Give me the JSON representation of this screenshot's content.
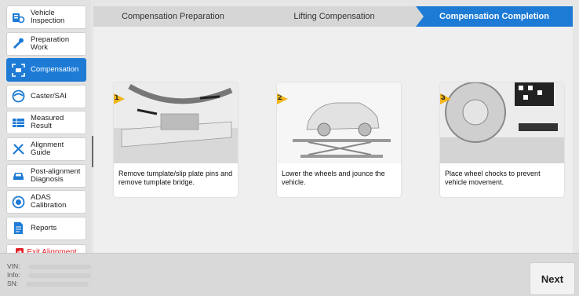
{
  "sidebar": {
    "items": [
      {
        "label": "Vehicle\nInspection",
        "icon": "vehicle-inspection-icon"
      },
      {
        "label": "Preparation\nWork",
        "icon": "wrench-icon"
      },
      {
        "label": "Compensation",
        "icon": "compensation-icon",
        "active": true
      },
      {
        "label": "Caster/SAI",
        "icon": "caster-icon"
      },
      {
        "label": "Measured\nResult",
        "icon": "table-icon"
      },
      {
        "label": "Alignment\nGuide",
        "icon": "tools-icon"
      },
      {
        "label": "Post-alignment\nDiagnosis",
        "icon": "car-icon"
      },
      {
        "label": "ADAS\nCalibration",
        "icon": "adas-icon"
      },
      {
        "label": "Reports",
        "icon": "document-icon"
      }
    ],
    "exit_label": "Exit Alignment"
  },
  "steps": [
    "Compensation Preparation",
    "Lifting Compensation",
    "Compensation Completion"
  ],
  "cards": [
    {
      "num": "1",
      "caption": "Remove tumplate/slip plate pins and remove tumplate bridge."
    },
    {
      "num": "2",
      "caption": "Lower the wheels and jounce the vehicle."
    },
    {
      "num": "3",
      "caption": "Place wheel chocks to prevent vehicle movement."
    }
  ],
  "footer": {
    "vin_label": "VIN:",
    "info_label": "Info:",
    "sn_label": "SN:",
    "next_label": "Next"
  },
  "colors": {
    "accent": "#1d7bd6",
    "exit": "#e0242b",
    "step_badge": "#f2b51c"
  }
}
